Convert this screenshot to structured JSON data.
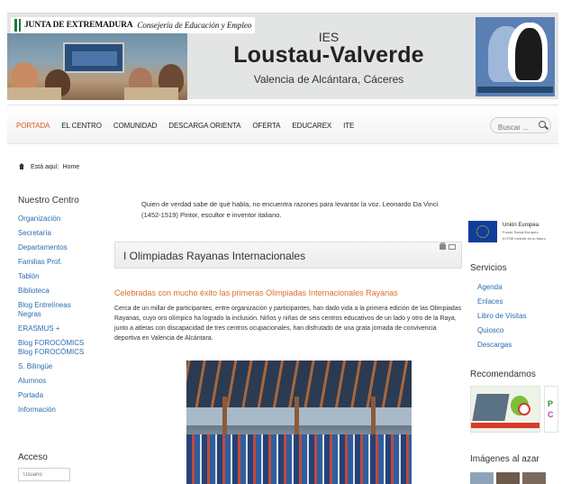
{
  "header": {
    "junta_label": "JUNTA DE EXTREMADURA",
    "consejeria": "Consejería de Educación y Empleo",
    "ies": "IES",
    "school_name": "Loustau-Valverde",
    "location": "Valencia de Alcántara, Cáceres",
    "colors": {
      "banner": "#e3e4e4",
      "logo": "#5a7fb4"
    }
  },
  "nav": {
    "items": [
      {
        "label": "PORTADA",
        "active": true
      },
      {
        "label": "EL CENTRO",
        "active": false
      },
      {
        "label": "COMUNIDAD",
        "active": false
      },
      {
        "label": "DESCARGA ORIENTA",
        "active": false
      },
      {
        "label": "OFERTA",
        "active": false
      },
      {
        "label": "EDUCAREX",
        "active": false
      },
      {
        "label": "ITE",
        "active": false
      }
    ],
    "search_placeholder": "Buscar ...",
    "accent": "#d9582b"
  },
  "breadcrumb": {
    "prefix": "Está aquí:",
    "current": "Home"
  },
  "left_sidebar": {
    "title": "Nuestro Centro",
    "items": [
      "Organización",
      "Secretaría",
      "Departamentos",
      "Familias Prof.",
      "Tablón",
      "Biblioteca",
      "Blog Entrelíneas Negras",
      "ERASMUS +",
      "Blog FOROCÓMICSBlog FOROCÓMICS",
      "S. Bilingüe",
      "Alumnos",
      "Portada",
      "Información"
    ],
    "access_title": "Acceso",
    "user_placeholder": "Usuario"
  },
  "main": {
    "quote": "Quien de verdad sabe de qué habla, no encuentra razones para levantar la voz. Leonardo Da Vinci (1452-1519) Pintor, escultor e inventor italiano.",
    "article_title": "I Olimpiadas Rayanas Internacionales",
    "subtitle": "Celebradas con mucho  éxito las primeras Olimpiadas Internacionales Rayanas",
    "body": "Cerca de un millar de participantes, entre organización y participantes, han dado vida a la primera edición de las Olimpiadas Rayanas, cuyo oro olímpico ha logrado la inclusión. Niños y niñas de seis centros educativos de un lado y otro de la Raya, junto a atletas con discapacidad de tres centros ocupacionales, han disfrutado de una grata jornada de convivencia deportiva en Valencia de Alcántara."
  },
  "right_sidebar": {
    "eu_title": "Unión Europea",
    "eu_fund": "Fondo Social Europeo",
    "eu_slogan": "El FSE invierte en tu futuro",
    "services_title": "Servicios",
    "services": [
      "Agenda",
      "Enlaces",
      "Libro de Visitas",
      "Quiosco",
      "Descargas"
    ],
    "recommend_title": "Recomendamos",
    "random_images_title": "Imágenes al azar"
  }
}
